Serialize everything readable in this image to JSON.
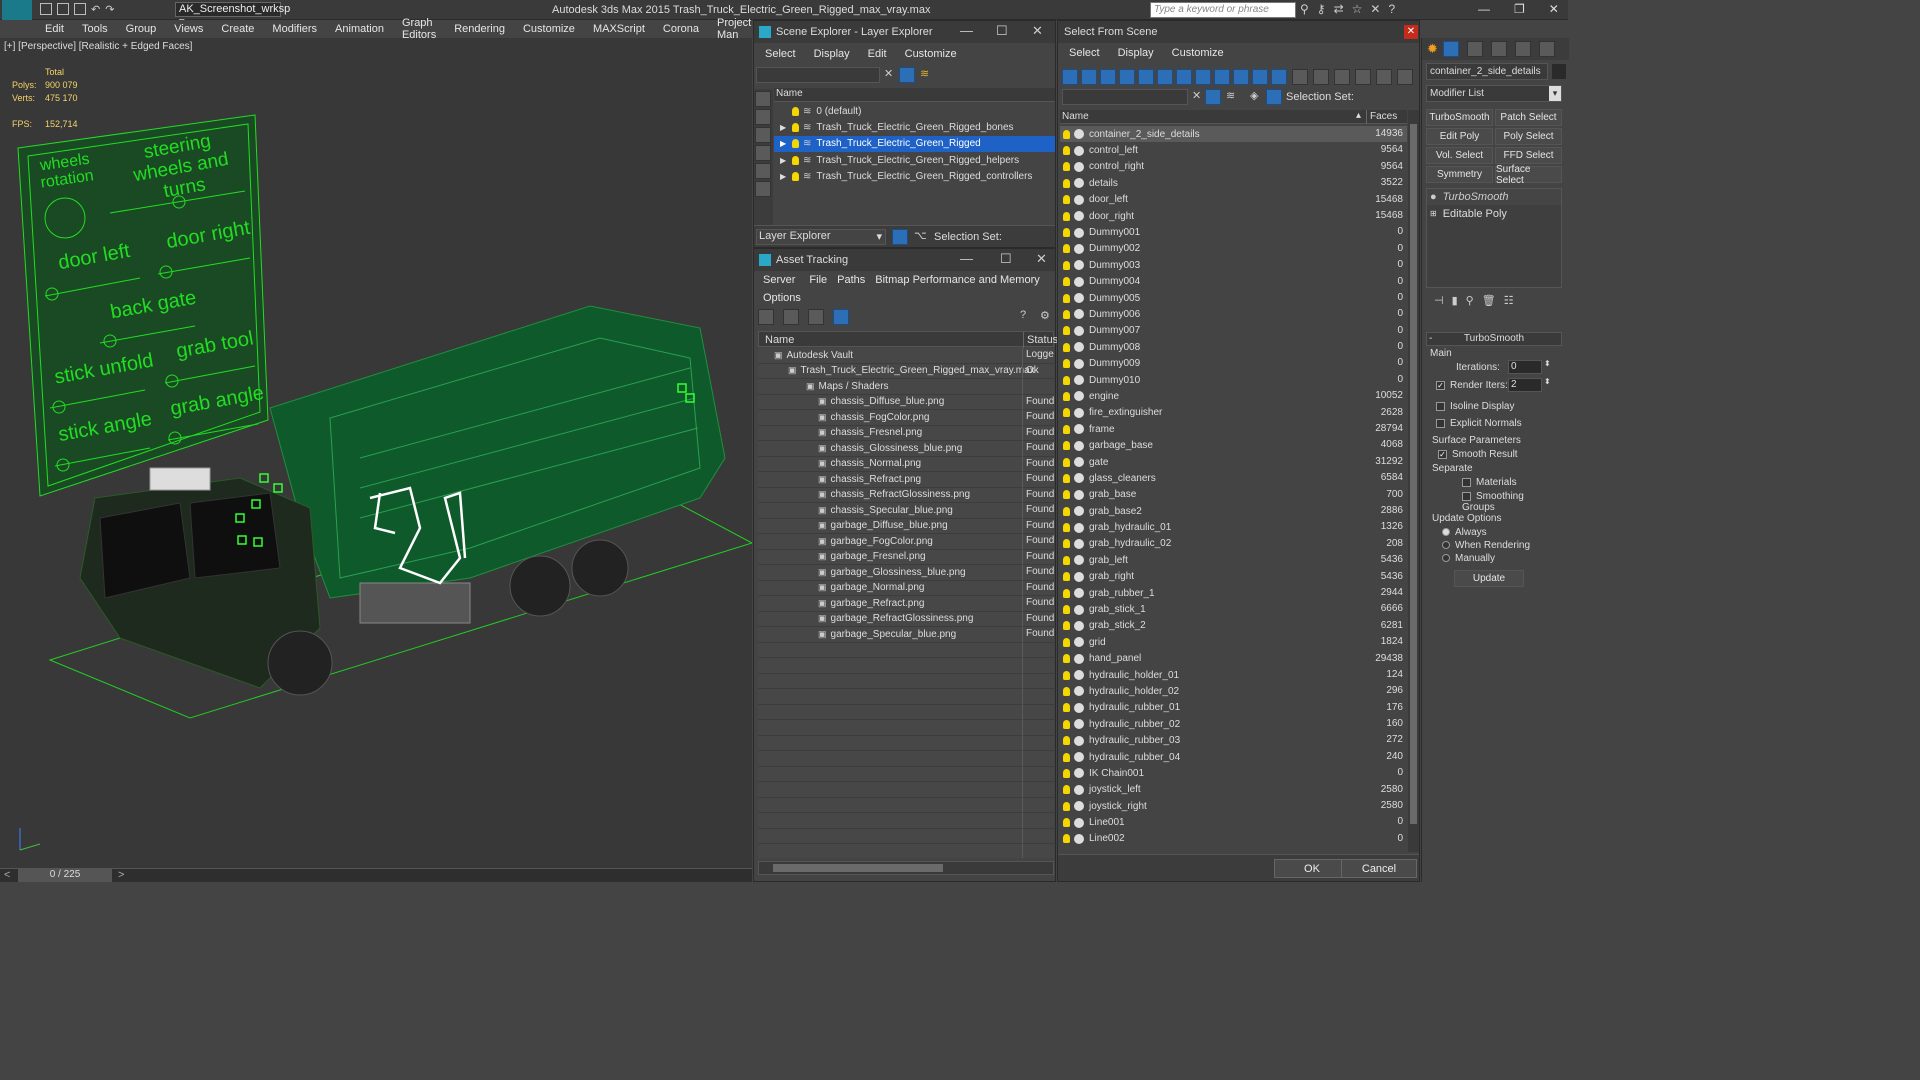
{
  "app_title": "Autodesk 3ds Max  2015     Trash_Truck_Electric_Green_Rigged_max_vray.max",
  "workspace": "AK_Screenshot_wrksp",
  "search_placeholder": "Type a keyword or phrase",
  "menu": [
    "Edit",
    "Tools",
    "Group",
    "Views",
    "Create",
    "Modifiers",
    "Animation",
    "Graph Editors",
    "Rendering",
    "Customize",
    "MAXScript",
    "Corona",
    "Project Man"
  ],
  "viewport": {
    "label": "[+] [Perspective] [Realistic + Edged Faces]",
    "total": "Total",
    "polys_label": "Polys:",
    "polys": "900 079",
    "verts_label": "Verts:",
    "verts": "475 170",
    "fps_label": "FPS:",
    "fps": "152,714",
    "rig_labels": [
      "wheels rotation",
      "steering wheels and turns",
      "door left",
      "door right",
      "back gate",
      "stick unfold",
      "grab tool",
      "stick angle",
      "grab angle"
    ]
  },
  "timeline": "0 / 225",
  "scene_explorer": {
    "title": "Scene Explorer - Layer Explorer",
    "menu": [
      "Select",
      "Display",
      "Edit",
      "Customize"
    ],
    "col": "Name",
    "layers": [
      "0 (default)",
      "Trash_Truck_Electric_Green_Rigged_bones",
      "Trash_Truck_Electric_Green_Rigged",
      "Trash_Truck_Electric_Green_Rigged_helpers",
      "Trash_Truck_Electric_Green_Rigged_controllers"
    ],
    "footer": "Layer Explorer",
    "selection_set": "Selection Set:"
  },
  "asset_tracking": {
    "title": "Asset Tracking",
    "menu": [
      "Server",
      "File",
      "Paths",
      "Bitmap Performance and Memory"
    ],
    "menu2": "Options",
    "col_name": "Name",
    "col_status": "Status",
    "rows": [
      {
        "name": "Autodesk Vault",
        "status": "Logged",
        "indent": 1
      },
      {
        "name": "Trash_Truck_Electric_Green_Rigged_max_vray.max",
        "status": "Ok",
        "indent": 2
      },
      {
        "name": "Maps / Shaders",
        "status": "",
        "indent": 3
      },
      {
        "name": "chassis_Diffuse_blue.png",
        "status": "Found",
        "indent": 4
      },
      {
        "name": "chassis_FogColor.png",
        "status": "Found",
        "indent": 4
      },
      {
        "name": "chassis_Fresnel.png",
        "status": "Found",
        "indent": 4
      },
      {
        "name": "chassis_Glossiness_blue.png",
        "status": "Found",
        "indent": 4
      },
      {
        "name": "chassis_Normal.png",
        "status": "Found",
        "indent": 4
      },
      {
        "name": "chassis_Refract.png",
        "status": "Found",
        "indent": 4
      },
      {
        "name": "chassis_RefractGlossiness.png",
        "status": "Found",
        "indent": 4
      },
      {
        "name": "chassis_Specular_blue.png",
        "status": "Found",
        "indent": 4
      },
      {
        "name": "garbage_Diffuse_blue.png",
        "status": "Found",
        "indent": 4
      },
      {
        "name": "garbage_FogColor.png",
        "status": "Found",
        "indent": 4
      },
      {
        "name": "garbage_Fresnel.png",
        "status": "Found",
        "indent": 4
      },
      {
        "name": "garbage_Glossiness_blue.png",
        "status": "Found",
        "indent": 4
      },
      {
        "name": "garbage_Normal.png",
        "status": "Found",
        "indent": 4
      },
      {
        "name": "garbage_Refract.png",
        "status": "Found",
        "indent": 4
      },
      {
        "name": "garbage_RefractGlossiness.png",
        "status": "Found",
        "indent": 4
      },
      {
        "name": "garbage_Specular_blue.png",
        "status": "Found",
        "indent": 4
      }
    ]
  },
  "select_from_scene": {
    "title": "Select From Scene",
    "menu": [
      "Select",
      "Display",
      "Customize"
    ],
    "selection_set": "Selection Set:",
    "col_name": "Name",
    "col_faces": "Faces",
    "ok": "OK",
    "cancel": "Cancel",
    "objects": [
      [
        "container_2_side_details",
        "14936"
      ],
      [
        "control_left",
        "9564"
      ],
      [
        "control_right",
        "9564"
      ],
      [
        "details",
        "3522"
      ],
      [
        "door_left",
        "15468"
      ],
      [
        "door_right",
        "15468"
      ],
      [
        "Dummy001",
        "0"
      ],
      [
        "Dummy002",
        "0"
      ],
      [
        "Dummy003",
        "0"
      ],
      [
        "Dummy004",
        "0"
      ],
      [
        "Dummy005",
        "0"
      ],
      [
        "Dummy006",
        "0"
      ],
      [
        "Dummy007",
        "0"
      ],
      [
        "Dummy008",
        "0"
      ],
      [
        "Dummy009",
        "0"
      ],
      [
        "Dummy010",
        "0"
      ],
      [
        "engine",
        "10052"
      ],
      [
        "fire_extinguisher",
        "2628"
      ],
      [
        "frame",
        "28794"
      ],
      [
        "garbage_base",
        "4068"
      ],
      [
        "gate",
        "31292"
      ],
      [
        "glass_cleaners",
        "6584"
      ],
      [
        "grab_base",
        "700"
      ],
      [
        "grab_base2",
        "2886"
      ],
      [
        "grab_hydraulic_01",
        "1326"
      ],
      [
        "grab_hydraulic_02",
        "208"
      ],
      [
        "grab_left",
        "5436"
      ],
      [
        "grab_right",
        "5436"
      ],
      [
        "grab_rubber_1",
        "2944"
      ],
      [
        "grab_stick_1",
        "6666"
      ],
      [
        "grab_stick_2",
        "6281"
      ],
      [
        "grid",
        "1824"
      ],
      [
        "hand_panel",
        "29438"
      ],
      [
        "hydraulic_holder_01",
        "124"
      ],
      [
        "hydraulic_holder_02",
        "296"
      ],
      [
        "hydraulic_rubber_01",
        "176"
      ],
      [
        "hydraulic_rubber_02",
        "160"
      ],
      [
        "hydraulic_rubber_03",
        "272"
      ],
      [
        "hydraulic_rubber_04",
        "240"
      ],
      [
        "IK Chain001",
        "0"
      ],
      [
        "joystick_left",
        "2580"
      ],
      [
        "joystick_right",
        "2580"
      ],
      [
        "Line001",
        "0"
      ],
      [
        "Line002",
        "0"
      ]
    ]
  },
  "command_panel": {
    "object_name": "container_2_side_details",
    "modifier_list": "Modifier List",
    "buttons": [
      "TurboSmooth",
      "Patch Select",
      "Edit Poly",
      "Poly Select",
      "Vol. Select",
      "FFD Select",
      "Symmetry",
      "Surface Select"
    ],
    "stack": [
      "TurboSmooth",
      "Editable Poly"
    ],
    "rollout_title": "TurboSmooth",
    "main": "Main",
    "iterations_label": "Iterations:",
    "iterations": "0",
    "render_iters_label": "Render Iters:",
    "render_iters": "2",
    "isoline": "Isoline Display",
    "explicit": "Explicit Normals",
    "surface_params": "Surface Parameters",
    "smooth_result": "Smooth Result",
    "separate": "Separate",
    "materials": "Materials",
    "smoothing_groups": "Smoothing Groups",
    "update_options": "Update Options",
    "always": "Always",
    "when_rendering": "When Rendering",
    "manually": "Manually",
    "update": "Update"
  },
  "colors": {
    "accent": "#2c6fb6",
    "selected_row": "#1f62c7",
    "wire_green": "#22dd22",
    "truck_green": "#0f5a2a"
  }
}
